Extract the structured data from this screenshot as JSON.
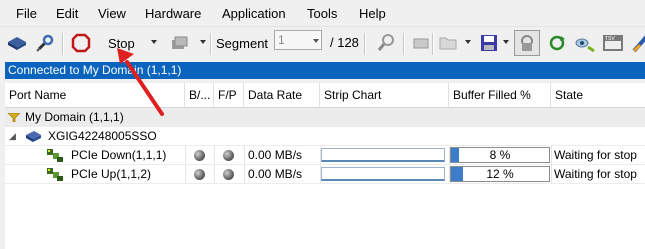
{
  "menu": {
    "items": [
      "File",
      "Edit",
      "View",
      "Hardware",
      "Application",
      "Tools",
      "Help"
    ]
  },
  "toolbar": {
    "stop_label": "Stop",
    "segment_label": "Segment",
    "segment_value": "1",
    "segment_total": "/ 128",
    "icons": [
      "hardware-icon",
      "connect-icon",
      "stop-icon",
      "device-icon",
      "search-icon",
      "open-folder-icon",
      "save-icon",
      "lock-icon",
      "refresh-icon",
      "tsv-icon",
      "chart-icon"
    ]
  },
  "status": {
    "text": "Connected to My Domain (1,1,1)"
  },
  "table": {
    "columns": [
      "Port Name",
      "B/...",
      "F/P",
      "Data Rate",
      "Strip Chart",
      "Buffer Filled %",
      "State"
    ],
    "domain": {
      "label": "My Domain (1,1,1)"
    },
    "device": {
      "label": "XGIG42248005SSO"
    },
    "ports": [
      {
        "name": "PCIe Down(1,1,1)",
        "data_rate": "0.00 MB/s",
        "buffer_text": "8 %",
        "state": "Waiting for stop"
      },
      {
        "name": "PCIe Up(1,1,2)",
        "data_rate": "0.00 MB/s",
        "buffer_text": "12 %",
        "state": "Waiting for stop"
      }
    ]
  },
  "chart_data": {
    "type": "bar",
    "categories": [
      "PCIe Down(1,1,1)",
      "PCIe Up(1,1,2)"
    ],
    "values": [
      8,
      12
    ],
    "ylim": [
      0,
      100
    ]
  },
  "colors": {
    "status_bar": "#0a64be",
    "buffer_fill": "#3c7cc8",
    "annotation_arrow": "#e02020"
  }
}
